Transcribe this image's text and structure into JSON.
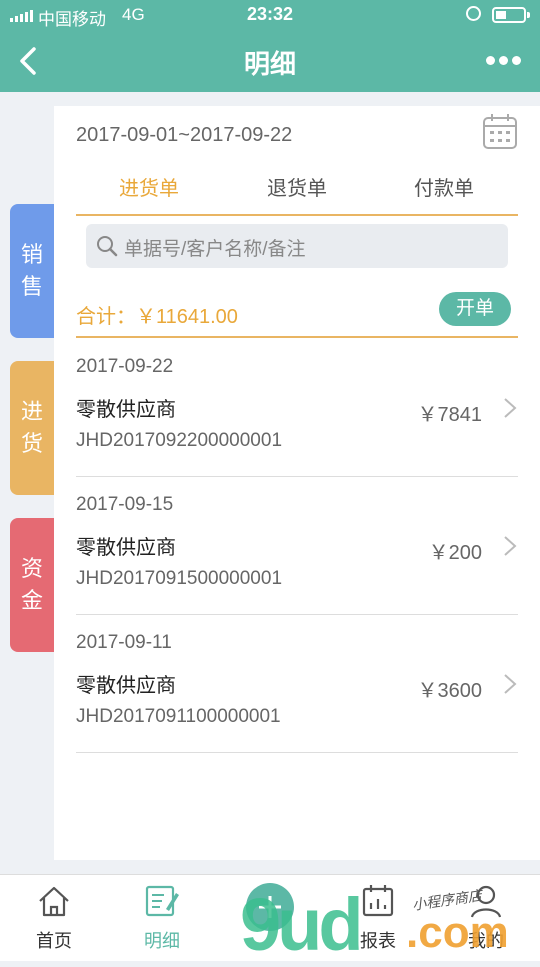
{
  "status_bar": {
    "carrier": "中国移动",
    "network": "4G",
    "time": "23:32"
  },
  "nav": {
    "title": "明细",
    "back_icon": "chevron-left-icon",
    "more_icon": "more-dots-icon"
  },
  "side_tabs": [
    {
      "label_1": "销",
      "label_2": "售",
      "color": "#6f9bea"
    },
    {
      "label_1": "进",
      "label_2": "货",
      "color": "#e9b563",
      "active": true
    },
    {
      "label_1": "资",
      "label_2": "金",
      "color": "#e56a73"
    }
  ],
  "filter": {
    "date_range": "2017-09-01~2017-09-22",
    "calendar_icon": "calendar-icon"
  },
  "doc_tabs": [
    {
      "label": "进货单",
      "active": true
    },
    {
      "label": "退货单",
      "active": false
    },
    {
      "label": "付款单",
      "active": false
    }
  ],
  "search": {
    "placeholder": "单据号/客户名称/备注",
    "icon": "search-icon"
  },
  "summary": {
    "total_label": "合计：",
    "total_value": "￥11641.00",
    "open_button": "开单"
  },
  "records": [
    {
      "date": "2017-09-22",
      "vendor": "零散供应商",
      "doc_no": "JHD2017092200000001",
      "amount": "￥7841"
    },
    {
      "date": "2017-09-15",
      "vendor": "零散供应商",
      "doc_no": "JHD2017091500000001",
      "amount": "￥200"
    },
    {
      "date": "2017-09-11",
      "vendor": "零散供应商",
      "doc_no": "JHD2017091100000001",
      "amount": "￥3600"
    }
  ],
  "tab_bar": [
    {
      "label": "首页",
      "icon": "home-icon",
      "active": false
    },
    {
      "label": "明细",
      "icon": "edit-list-icon",
      "active": true
    },
    {
      "label": "",
      "icon": "add-icon",
      "active": false
    },
    {
      "label": "报表",
      "icon": "report-icon",
      "active": false
    },
    {
      "label": "我的",
      "icon": "user-icon",
      "active": false
    }
  ],
  "watermark": {
    "logo_text": "9ud.com",
    "sign_text": "小程序商店"
  },
  "colors": {
    "primary": "#5cb8a6",
    "accent": "#e9a83a",
    "sales": "#6f9bea",
    "purchase": "#e9b563",
    "funds": "#e56a73"
  }
}
